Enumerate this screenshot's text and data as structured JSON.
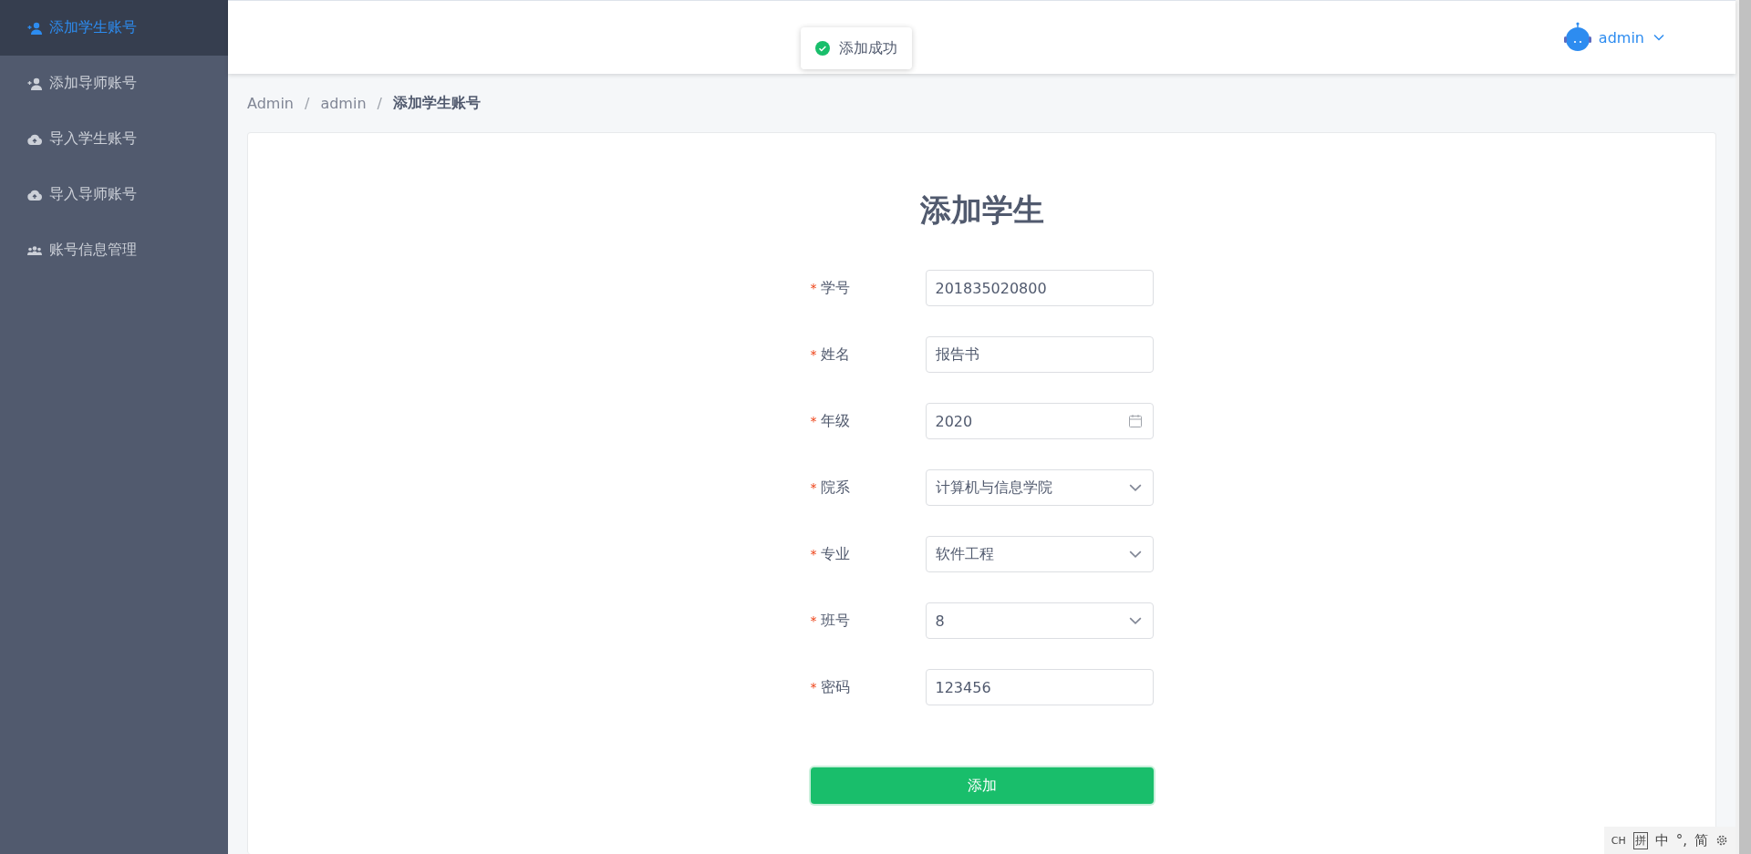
{
  "sidebar": {
    "items": [
      {
        "label": "添加学生账号",
        "kind": "person-add",
        "selected": true
      },
      {
        "label": "添加导师账号",
        "kind": "person-add",
        "selected": false
      },
      {
        "label": "导入学生账号",
        "kind": "cloud-upload",
        "selected": false
      },
      {
        "label": "导入导师账号",
        "kind": "cloud-upload",
        "selected": false
      },
      {
        "label": "账号信息管理",
        "kind": "group",
        "selected": false
      }
    ]
  },
  "header": {
    "user": "admin"
  },
  "toast": {
    "kind": "success",
    "message": "添加成功"
  },
  "breadcrumb": [
    {
      "kind": "link",
      "text": "Admin"
    },
    {
      "kind": "separator",
      "text": "/"
    },
    {
      "kind": "link",
      "text": "admin"
    },
    {
      "kind": "separator",
      "text": "/"
    },
    {
      "kind": "current",
      "text": "添加学生账号"
    }
  ],
  "form": {
    "title": "添加学生",
    "fields": [
      {
        "mark": "*",
        "label": "学号",
        "kind": "input",
        "value": "201835020800"
      },
      {
        "mark": "*",
        "label": "姓名",
        "kind": "input",
        "value": "报告书"
      },
      {
        "mark": "*",
        "label": "年级",
        "kind": "date",
        "value": "2020"
      },
      {
        "mark": "*",
        "label": "院系",
        "kind": "select",
        "value": "计算机与信息学院"
      },
      {
        "mark": "*",
        "label": "专业",
        "kind": "select",
        "value": "软件工程"
      },
      {
        "mark": "*",
        "label": "班号",
        "kind": "select",
        "value": "8"
      },
      {
        "mark": "*",
        "label": "密码",
        "kind": "input",
        "value": "123456"
      }
    ],
    "submit": "添加"
  },
  "ime_bar": {
    "items": [
      "CH",
      "拼",
      "中",
      "°,",
      "简"
    ]
  }
}
